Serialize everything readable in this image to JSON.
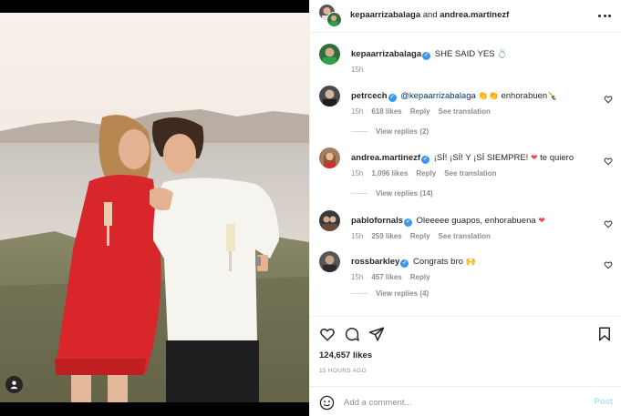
{
  "post": {
    "author": "kepaarrizabalaga",
    "collaborator": "andrea.martinezf",
    "joiner": "and",
    "caption_author": "kepaarrizabalaga",
    "caption_text": "SHE SAID YES",
    "caption_emoji": "💍",
    "caption_time": "15h",
    "likes": "124,657 likes",
    "time_ago": "15 HOURS AGO"
  },
  "comments": [
    {
      "username": "petrcech",
      "verified": true,
      "mention": "@kepaarrizabalaga",
      "text": "enhorabuen",
      "emoji_pre": "👏👏",
      "emoji_post": "🍾",
      "time": "15h",
      "likes": "618 likes",
      "reply": "Reply",
      "translate": "See translation",
      "view_replies": "View replies (2)"
    },
    {
      "username": "andrea.martinezf",
      "verified": true,
      "text": "¡SÍ! ¡SÍ! Y ¡SÍ SIEMPRE!",
      "emoji_post": "❤",
      "text_after": "te quiero",
      "time": "15h",
      "likes": "1,096 likes",
      "reply": "Reply",
      "translate": "See translation",
      "view_replies": "View replies (14)"
    },
    {
      "username": "pablofornals",
      "verified": true,
      "text": "Oleeeee guapos, enhorabuena",
      "emoji_post": "❤",
      "time": "15h",
      "likes": "259 likes",
      "reply": "Reply",
      "translate": "See translation"
    },
    {
      "username": "rossbarkley",
      "verified": true,
      "text": "Congrats bro",
      "emoji_post": "🙌",
      "time": "15h",
      "likes": "457 likes",
      "reply": "Reply",
      "view_replies": "View replies (4)"
    }
  ],
  "add_comment": {
    "placeholder": "Add a comment...",
    "post_label": "Post"
  },
  "colors": {
    "link": "#00376b",
    "verified": "#3897f0",
    "muted": "#8e8e8e",
    "post_disabled": "#b2dffc",
    "heart_red": "#ed4956"
  },
  "icons": {
    "like": "heart-icon",
    "comment": "comment-icon",
    "share": "paper-plane-icon",
    "save": "bookmark-icon",
    "emoji": "smiley-icon",
    "more": "more-horizontal-icon",
    "tag": "user-tag-icon"
  }
}
